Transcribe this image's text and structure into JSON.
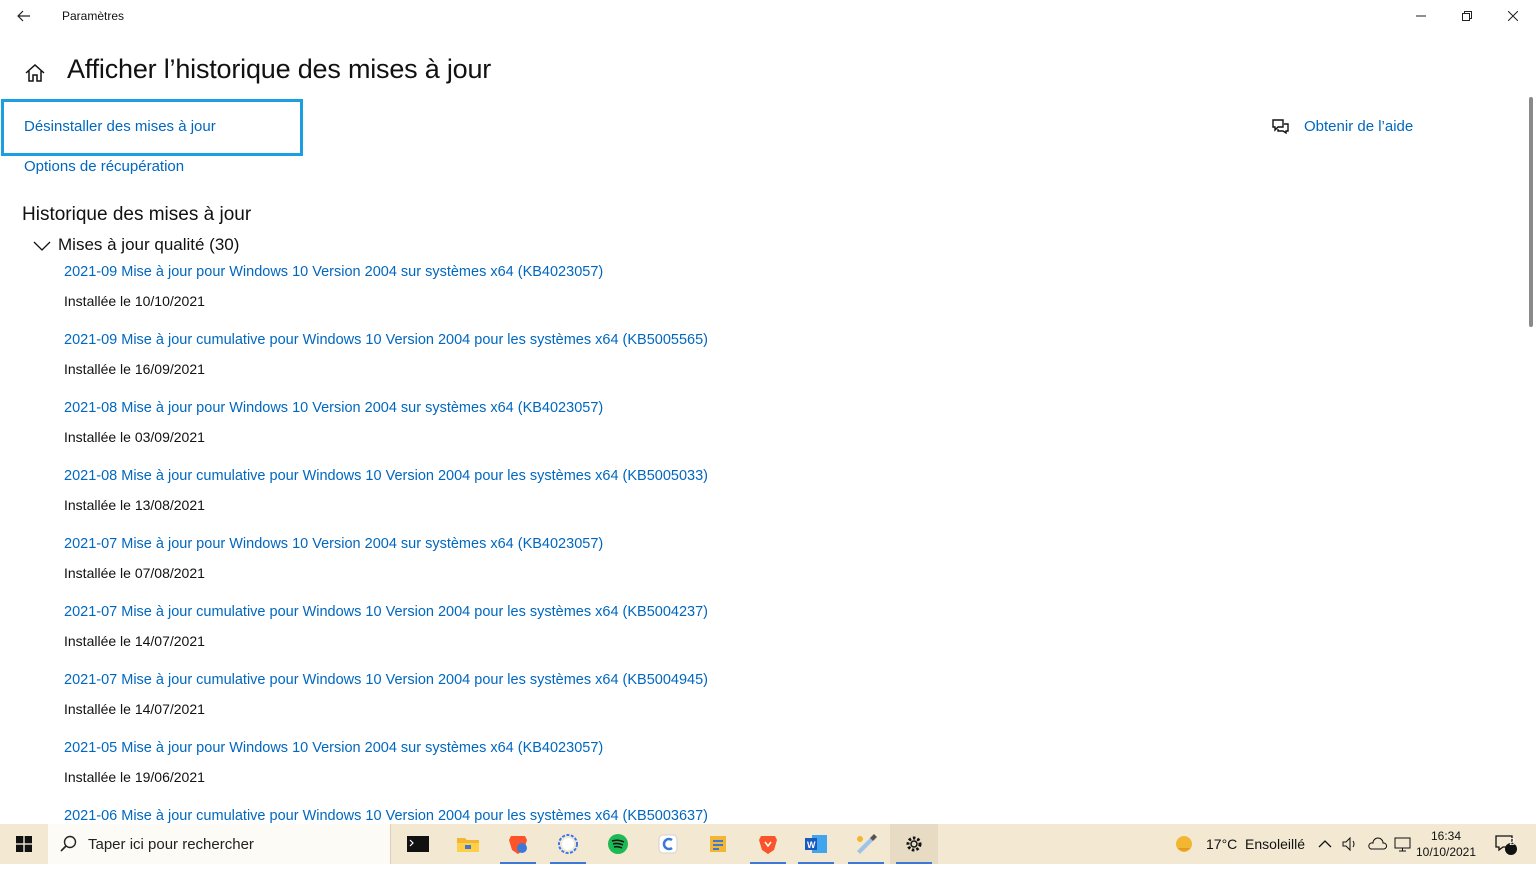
{
  "window": {
    "app_title": "Paramètres",
    "page_title": "Afficher l’historique des mises à jour"
  },
  "links": {
    "uninstall": "Désinstaller des mises à jour",
    "recovery": "Options de récupération",
    "help": "Obtenir de l’aide"
  },
  "history": {
    "title": "Historique des mises à jour",
    "section_label": "Mises à jour qualité (30)",
    "updates": [
      {
        "title": "2021-09 Mise à jour pour Windows 10 Version 2004 sur systèmes x64 (KB4023057)",
        "date": "Installée le 10/10/2021"
      },
      {
        "title": "2021-09 Mise à jour cumulative pour Windows 10 Version 2004 pour les systèmes x64 (KB5005565)",
        "date": "Installée le 16/09/2021"
      },
      {
        "title": "2021-08 Mise à jour pour Windows 10 Version 2004 sur systèmes x64 (KB4023057)",
        "date": "Installée le 03/09/2021"
      },
      {
        "title": "2021-08 Mise à jour cumulative pour Windows 10 Version 2004 pour les systèmes x64 (KB5005033)",
        "date": "Installée le 13/08/2021"
      },
      {
        "title": "2021-07 Mise à jour pour Windows 10 Version 2004 sur systèmes x64 (KB4023057)",
        "date": "Installée le 07/08/2021"
      },
      {
        "title": "2021-07 Mise à jour cumulative pour Windows 10 Version 2004 pour les systèmes x64 (KB5004237)",
        "date": "Installée le 14/07/2021"
      },
      {
        "title": "2021-07 Mise à jour cumulative pour Windows 10 Version 2004 pour les systèmes x64 (KB5004945)",
        "date": "Installée le 14/07/2021"
      },
      {
        "title": "2021-05 Mise à jour pour Windows 10 Version 2004 sur systèmes x64 (KB4023057)",
        "date": "Installée le 19/06/2021"
      },
      {
        "title": "2021-06 Mise à jour cumulative pour Windows 10 Version 2004 pour les systèmes x64 (KB5003637)",
        "date": ""
      }
    ]
  },
  "taskbar": {
    "search_placeholder": "Taper ici pour rechercher",
    "weather": "17°C  Ensoleillé",
    "time": "16:34",
    "date": "10/10/2021",
    "notification_count": "2",
    "apps": [
      "terminal-icon",
      "file-explorer-icon",
      "brave-icon",
      "signal-icon",
      "spotify-icon",
      "app-icon",
      "tool-icon",
      "brave-icon",
      "word-icon",
      "paint-icon",
      "settings-icon"
    ]
  },
  "colors": {
    "link": "#0067c0",
    "highlight_border": "#1aa0e0",
    "taskbar_bg": "#f3e9d3"
  }
}
